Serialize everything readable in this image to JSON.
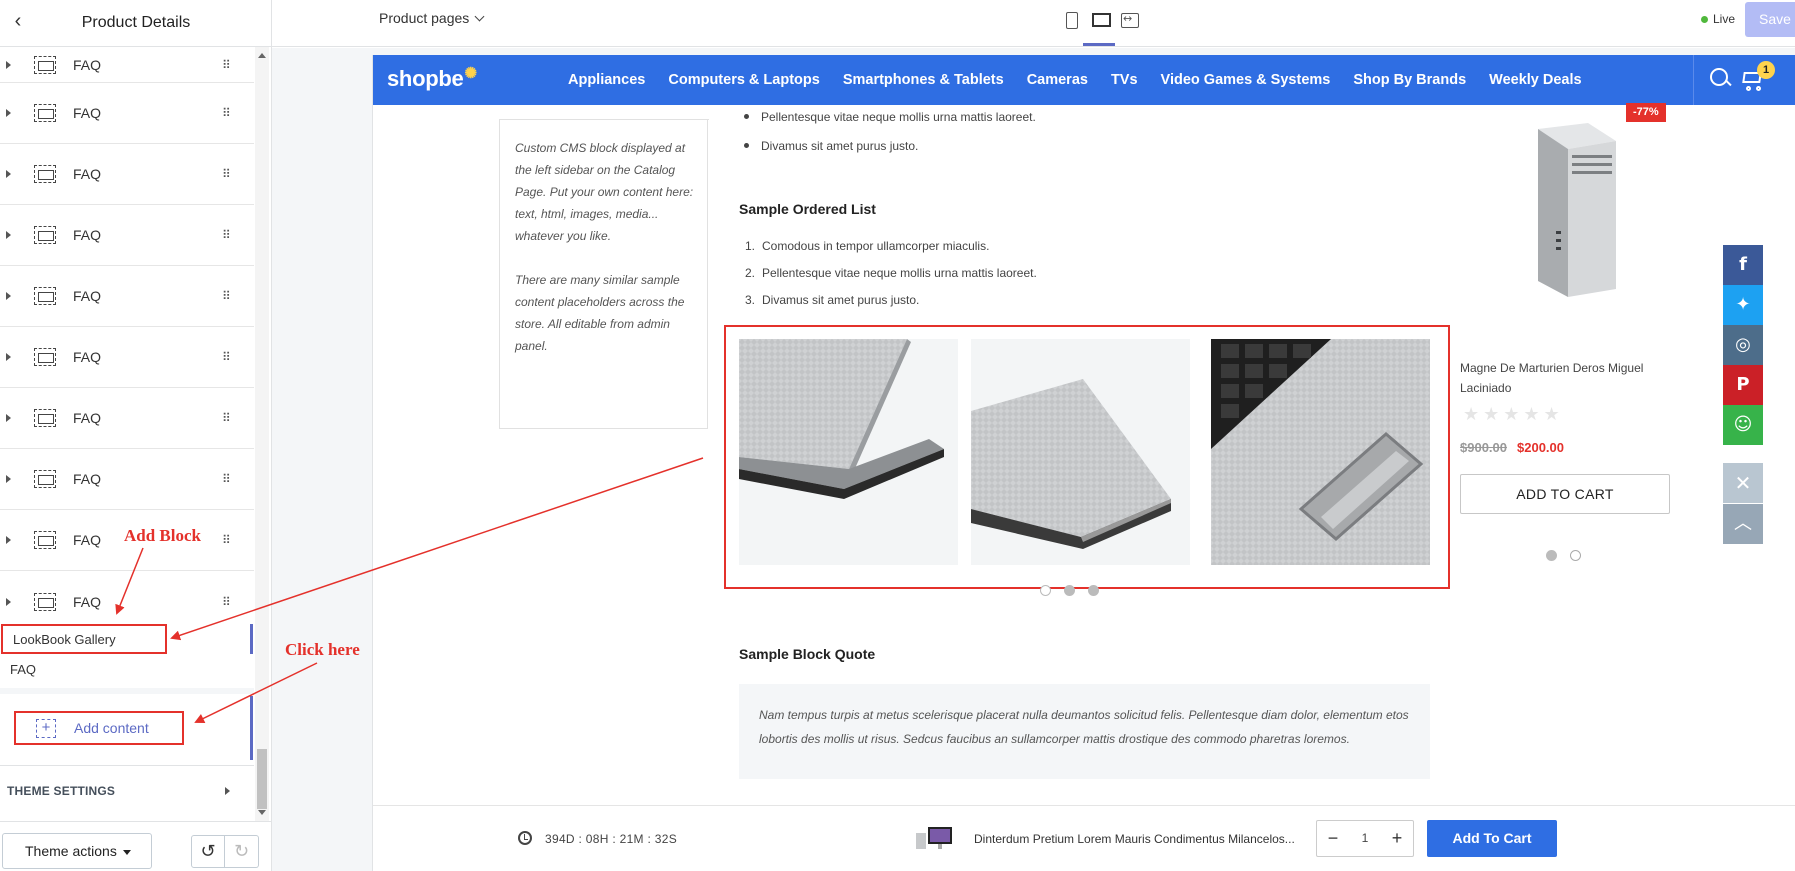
{
  "sidebar": {
    "title": "Product Details",
    "items": [
      {
        "label": "FAQ"
      },
      {
        "label": "FAQ"
      },
      {
        "label": "FAQ"
      },
      {
        "label": "FAQ"
      },
      {
        "label": "FAQ"
      },
      {
        "label": "FAQ"
      },
      {
        "label": "FAQ"
      },
      {
        "label": "FAQ"
      },
      {
        "label": "FAQ"
      },
      {
        "label": "FAQ"
      }
    ],
    "sub_blocks": [
      "LookBook Gallery",
      "FAQ"
    ],
    "add_content": "Add content",
    "theme_settings": "THEME SETTINGS",
    "theme_actions": "Theme actions"
  },
  "annotations": {
    "add_block": "Add Block",
    "click_here": "Click here"
  },
  "topbar": {
    "page_select": "Product pages",
    "live": "Live",
    "save": "Save"
  },
  "store": {
    "logo": "shopbe",
    "nav": [
      "Appliances",
      "Computers & Laptops",
      "Smartphones & Tablets",
      "Cameras",
      "TVs",
      "Video Games & Systems",
      "Shop By Brands",
      "Weekly Deals"
    ],
    "cart_count": "1",
    "cms_text_1": "Custom CMS block displayed at the left sidebar on the Catalog Page. Put your own content here: text, html, images, media... whatever you like.",
    "cms_text_2": "There are many similar sample content placeholders across the store. All editable from admin panel.",
    "ul_items": [
      "Pellentesque vitae neque mollis urna mattis laoreet.",
      "Divamus sit amet purus justo."
    ],
    "ordered_heading": "Sample Ordered List",
    "ol_items": [
      {
        "n": "1.",
        "text": "Comodous in tempor ullamcorper miaculis."
      },
      {
        "n": "2.",
        "text": "Pellentesque vitae neque mollis urna mattis laoreet."
      },
      {
        "n": "3.",
        "text": "Divamus sit amet purus justo."
      }
    ],
    "quote_heading": "Sample Block Quote",
    "quote_text": "Nam tempus turpis at metus scelerisque placerat nulla deumantos solicitud felis. Pellentesque diam dolor, elementum etos lobortis des mollis ut risus. Sedcus faucibus an sullamcorper mattis drostique des commodo pharetras loremos.",
    "product": {
      "badge": "-77%",
      "name": "Magne De Marturien Deros Miguel Laciniado",
      "stars": "★★★★★",
      "old_price": "$900.00",
      "new_price": "$200.00",
      "add_to_cart": "ADD TO CART"
    },
    "sticky": {
      "timer": "394D : 08H : 21M : 32S",
      "name": "Dinterdum Pretium Lorem Mauris Condimentus Milancelos...",
      "qty": "1",
      "button": "Add To Cart"
    }
  },
  "colors": {
    "accent": "#5c6ac4",
    "brand": "#2f6ee3",
    "annotation": "#e4312b",
    "sale": "#e4312b"
  }
}
